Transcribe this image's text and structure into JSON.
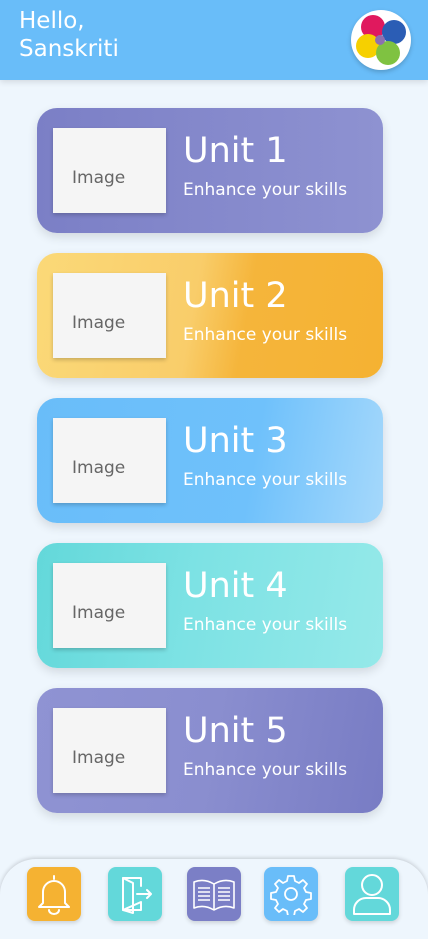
{
  "header": {
    "greeting": "Hello,\nSanskriti",
    "logo_icon": "flower-logo-icon"
  },
  "units": [
    {
      "title": "Unit 1",
      "subtitle": "Enhance your skills",
      "image_label": "Image"
    },
    {
      "title": "Unit 2",
      "subtitle": "Enhance your skills",
      "image_label": "Image"
    },
    {
      "title": "Unit 3",
      "subtitle": "Enhance your skills",
      "image_label": "Image"
    },
    {
      "title": "Unit 4",
      "subtitle": "Enhance your skills",
      "image_label": "Image"
    },
    {
      "title": "Unit 5",
      "subtitle": "Enhance your skills",
      "image_label": "Image"
    }
  ],
  "bottom_nav": [
    {
      "icon": "bell-icon",
      "color": "#f5b232"
    },
    {
      "icon": "logout-door-icon",
      "color": "#63d8da"
    },
    {
      "icon": "open-book-icon",
      "color": "#7b7fc6"
    },
    {
      "icon": "gear-icon",
      "color": "#69bdf9"
    },
    {
      "icon": "user-profile-icon",
      "color": "#63d8da"
    }
  ],
  "colors": {
    "header": "#69bdf9",
    "background": "#eef6fd"
  }
}
